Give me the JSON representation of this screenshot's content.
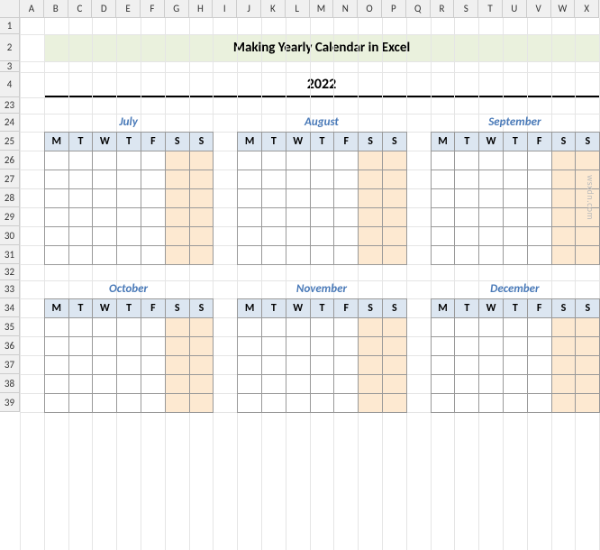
{
  "columns": [
    "A",
    "B",
    "C",
    "D",
    "E",
    "F",
    "G",
    "H",
    "I",
    "J",
    "K",
    "L",
    "M",
    "N",
    "O",
    "P",
    "Q",
    "R",
    "S",
    "T",
    "U",
    "V",
    "W",
    "X"
  ],
  "rows": [
    "1",
    "2",
    "3",
    "4",
    "23",
    "24",
    "25",
    "26",
    "27",
    "28",
    "29",
    "30",
    "31",
    "32",
    "33",
    "34",
    "35",
    "36",
    "37",
    "38",
    "39"
  ],
  "title": "Making Yearly Calendar in Excel",
  "year": "2022",
  "day_headers": [
    "M",
    "T",
    "W",
    "T",
    "F",
    "S",
    "S"
  ],
  "months": {
    "m1": "July",
    "m2": "August",
    "m3": "September",
    "m4": "October",
    "m5": "November",
    "m6": "December"
  },
  "watermark": "wsxdn.com"
}
